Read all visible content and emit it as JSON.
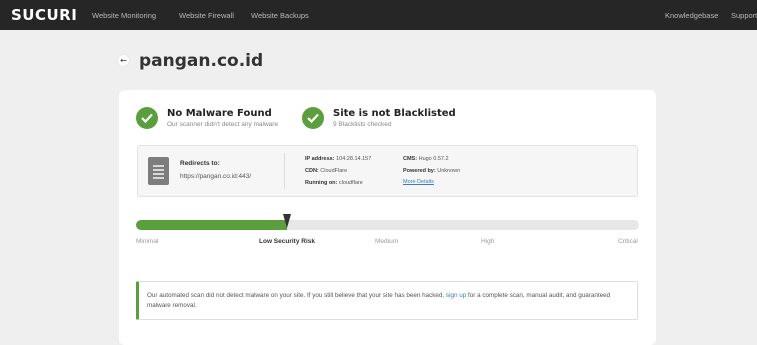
{
  "nav": {
    "logo": "SUCURI",
    "links": [
      "Website Monitoring",
      "Website Firewall",
      "Website Backups"
    ],
    "right_links": [
      "Knowledgebase",
      "Support"
    ]
  },
  "header": {
    "back_icon": "arrow-left-icon",
    "site": "pangan.co.id"
  },
  "status": {
    "malware_title": "No Malware Found",
    "malware_sub": "Our scanner didn't detect any malware",
    "blacklist_title": "Site is not Blacklisted",
    "blacklist_sub": "9 Blacklists checked",
    "ok_color": "#5b9e3d"
  },
  "info": {
    "redirect_label": "Redirects to:",
    "redirect_url": "https://pangan.co.id:443/",
    "ip_label": "IP address:",
    "ip_value": "104.28.14.157",
    "cdn_label": "CDN:",
    "cdn_value": "CloudFlare",
    "running_label": "Running on:",
    "running_value": "cloudflare",
    "cms_label": "CMS:",
    "cms_value": "Hugo 0.57.2",
    "powered_label": "Powered by:",
    "powered_value": "Unknown",
    "more_details": "More Details"
  },
  "risk": {
    "levels": [
      "Minimal",
      "Low Security Risk",
      "Medium",
      "High",
      "Critical"
    ],
    "active_index": 1,
    "fraction": 0.3
  },
  "notice": {
    "text_before": "Our automated scan did not detect malware on your site. If you still believe that your site has been hacked,",
    "link": "sign up",
    "text_after": "for a complete scan, manual audit, and guaranteed malware removal."
  }
}
